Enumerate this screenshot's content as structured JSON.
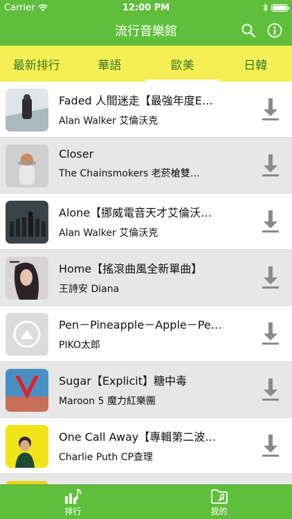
{
  "status_bar": {
    "carrier": "Carrier",
    "time": "12:00 PM"
  },
  "nav": {
    "title": "流行音樂館",
    "search_icon": "search-icon",
    "info_icon": "info-icon"
  },
  "tabs": [
    {
      "label": "最新排行",
      "active": false
    },
    {
      "label": "華語",
      "active": false
    },
    {
      "label": "歐美",
      "active": true
    },
    {
      "label": "日韓",
      "active": false
    }
  ],
  "songs": [
    {
      "title": "Faded 人間迷走【最強年度E…",
      "artist": "Alan Walker 艾倫沃克"
    },
    {
      "title": "Closer",
      "artist": "The Chainsmokers 老菸槍雙…"
    },
    {
      "title": "Alone【挪威電音天才艾倫沃…",
      "artist": "Alan Walker 艾倫沃克"
    },
    {
      "title": "Home【搖滾曲風全新單曲】",
      "artist": "王詩安 Diana"
    },
    {
      "title": "Pen－Pineapple－Apple－Pe…",
      "artist": "PIKO太郎"
    },
    {
      "title": "Sugar【Explicit】糖中毒",
      "artist": "Maroon 5 魔力紅樂團"
    },
    {
      "title": "One Call Away【專輯第二波…",
      "artist": "Charlie Puth CP查理"
    }
  ],
  "bottom_tabs": [
    {
      "label": "排行",
      "icon": "chart-music-icon"
    },
    {
      "label": "我的",
      "icon": "music-folder-icon"
    }
  ],
  "colors": {
    "primary_green": "#5fbf3c",
    "tab_yellow": "#f5ef55",
    "tab_text": "#3a7a2a",
    "download_gray": "#8a8a8a"
  }
}
